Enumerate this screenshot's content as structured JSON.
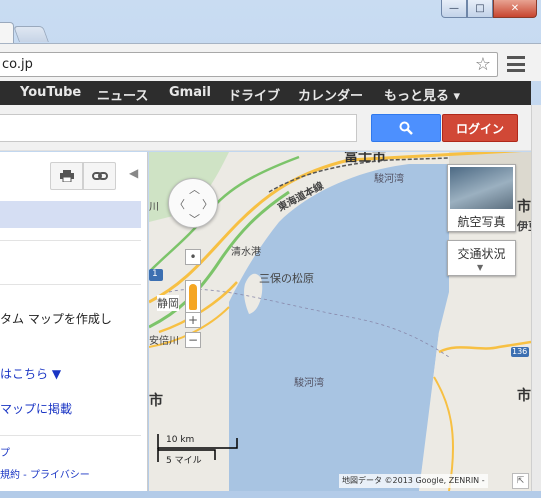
{
  "browser": {
    "url_text": "co.jp",
    "star_icon": "star-icon",
    "window_buttons": {
      "minimize": "—",
      "maximize": "□",
      "close": "✕"
    }
  },
  "gbar": {
    "items": [
      {
        "label": "YouTube"
      },
      {
        "label": "ニュース"
      },
      {
        "label": "Gmail"
      },
      {
        "label": "ドライブ"
      },
      {
        "label": "カレンダー"
      },
      {
        "label": "もっと見る ▾"
      }
    ]
  },
  "search": {
    "login_label": "ログイン",
    "search_icon": "🔍"
  },
  "panel": {
    "custom_map_text": "タム マップを作成し",
    "here_link": "はこちら ▼",
    "embed_link": "マップに掲載",
    "footer_line1": "プ",
    "footer_line2": "規約 - プライバシー"
  },
  "map": {
    "labels": {
      "fuji": "富士市",
      "suruga_top": "駿河湾",
      "railway": "東海道本線",
      "shimizu_port": "清水港",
      "miho": "三保の松原",
      "shizuoka": "静岡",
      "abekawa": "安倍川",
      "suruga_mid": "駿河湾",
      "city_left": "市",
      "city_right_top": "市",
      "izu": "伊豆",
      "left_top": "川",
      "left_road": "1",
      "route_136": "136",
      "city_right_mid": "市"
    },
    "aerial_label": "航空写真",
    "traffic_label": "交通状況",
    "scale": {
      "km": "10 km",
      "mile": "5 マイル"
    },
    "copyright": "地図データ ©2013 Google, ZENRIN -"
  },
  "colors": {
    "sea": "#a8c4e2",
    "land": "#eceae4",
    "highway": "#f7c043",
    "green_road": "#7cc46a",
    "gbar": "#2d2d2d",
    "search_blue": "#4d90fe",
    "login_red": "#d14836"
  }
}
